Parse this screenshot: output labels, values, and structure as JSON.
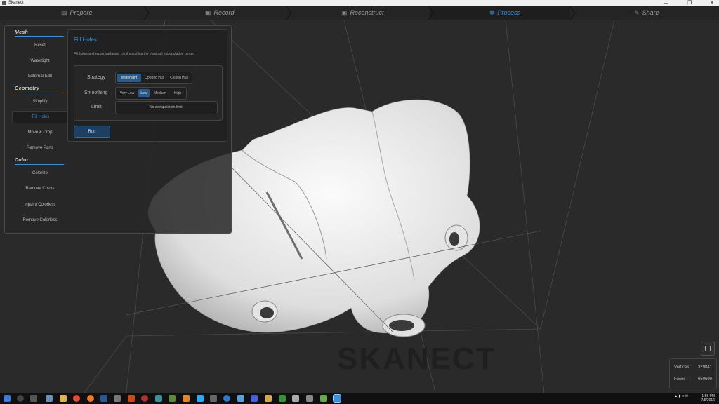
{
  "window": {
    "title": "Skanect"
  },
  "steps": [
    {
      "label": "Prepare",
      "icon": "prepare-icon"
    },
    {
      "label": "Record",
      "icon": "record-icon"
    },
    {
      "label": "Reconstruct",
      "icon": "reconstruct-icon"
    },
    {
      "label": "Process",
      "icon": "process-icon",
      "active": true
    },
    {
      "label": "Share",
      "icon": "share-icon"
    }
  ],
  "sidebar": {
    "sections": [
      {
        "title": "Mesh",
        "items": [
          "Reset",
          "Watertight",
          "External Edit"
        ]
      },
      {
        "title": "Geometry",
        "items": [
          "Simplify",
          "Fill Holes",
          "Move & Crop",
          "Remove Parts"
        ]
      },
      {
        "title": "Color",
        "items": [
          "Colorize",
          "Remove Colors",
          "Inpaint Colorless",
          "Remove Colorless"
        ]
      }
    ],
    "selected": "Fill Holes"
  },
  "fill_holes": {
    "title": "Fill Holes",
    "description": "Fill holes and repair surfaces. Limit specifies the maximal extrapolation range.",
    "strategy_label": "Strategy",
    "strategy_options": [
      "Watertight",
      "Opened Hull",
      "Closed Hull"
    ],
    "strategy_selected": "Watertight",
    "smoothing_label": "Smoothing",
    "smoothing_options": [
      "Very Low",
      "Low",
      "Medium",
      "High"
    ],
    "smoothing_selected": "Low",
    "limit_label": "Limit",
    "limit_value": "No extrapolation limit.",
    "run_label": "Run"
  },
  "stats": {
    "vertices_label": "Vertices :",
    "vertices": "329841",
    "faces_label": "Faces :",
    "faces": "659690"
  },
  "watermark": "SKANECT",
  "tray": {
    "time": "1:55 PM",
    "date": "7/5/2016"
  },
  "colors": {
    "accent": "#3b8fd6",
    "selected_bg": "#2a5a8a"
  }
}
